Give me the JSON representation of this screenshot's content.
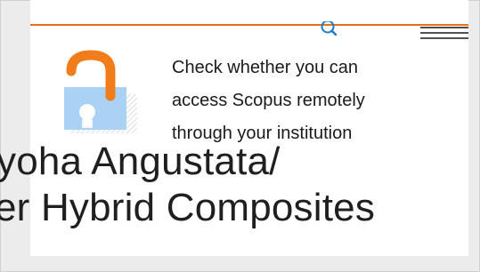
{
  "article": {
    "title_line_1": "yoha Angustata/",
    "title_line_2": "er Hybrid Composites"
  },
  "remote_access_prompt": {
    "lines": [
      "Check whether you can",
      "access Scopus remotely",
      "through your institution"
    ]
  },
  "header": {
    "accent_color": "#e9711c",
    "search_icon": "search-icon",
    "menu_icon": "hamburger-menu-icon"
  },
  "lock_icon": {
    "name": "open-padlock-icon",
    "shackle_color": "#f07c1a",
    "body_color": "#a9d2f5"
  }
}
